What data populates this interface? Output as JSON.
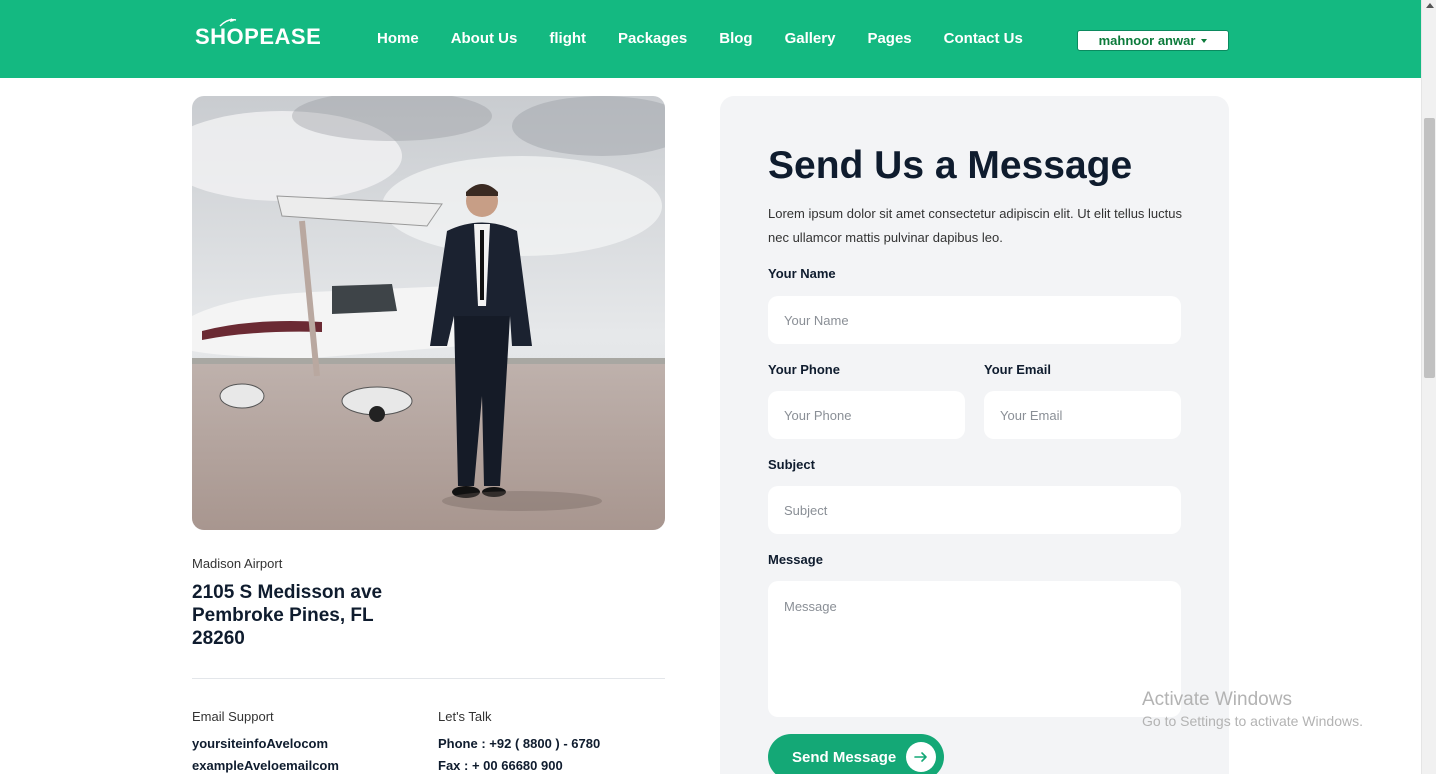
{
  "header": {
    "logo": "SHOPEASE",
    "nav": [
      "Home",
      "About Us",
      "flight",
      "Packages",
      "Blog",
      "Gallery",
      "Pages",
      "Contact Us"
    ],
    "user": "mahnoor anwar"
  },
  "location": {
    "label": "Madison Airport",
    "address": "2105 S Medisson ave Pembroke Pines, FL 28260"
  },
  "email_support": {
    "label": "Email Support",
    "lines": [
      "yoursiteinfoAvelocom",
      "exampleAveloemailcom"
    ]
  },
  "lets_talk": {
    "label": "Let's Talk",
    "lines": [
      "Phone : +92 ( 8800 ) - 6780",
      "Fax : + 00 66680 900"
    ]
  },
  "form": {
    "title": "Send Us a Message",
    "description": "Lorem ipsum dolor sit amet consectetur adipiscin elit. Ut elit tellus luctus nec ullamcor mattis pulvinar dapibus leo.",
    "name_label": "Your Name",
    "name_placeholder": "Your Name",
    "phone_label": "Your Phone",
    "phone_placeholder": "Your Phone",
    "email_label": "Your Email",
    "email_placeholder": "Your Email",
    "subject_label": "Subject",
    "subject_placeholder": "Subject",
    "message_label": "Message",
    "message_placeholder": "Message",
    "submit_label": "Send Message"
  },
  "watermark": {
    "title": "Activate Windows",
    "subtitle": "Go to Settings to activate Windows."
  },
  "colors": {
    "brand": "#14b981",
    "button": "#14a876",
    "heading": "#0f1c2e",
    "card": "#f3f4f6"
  }
}
